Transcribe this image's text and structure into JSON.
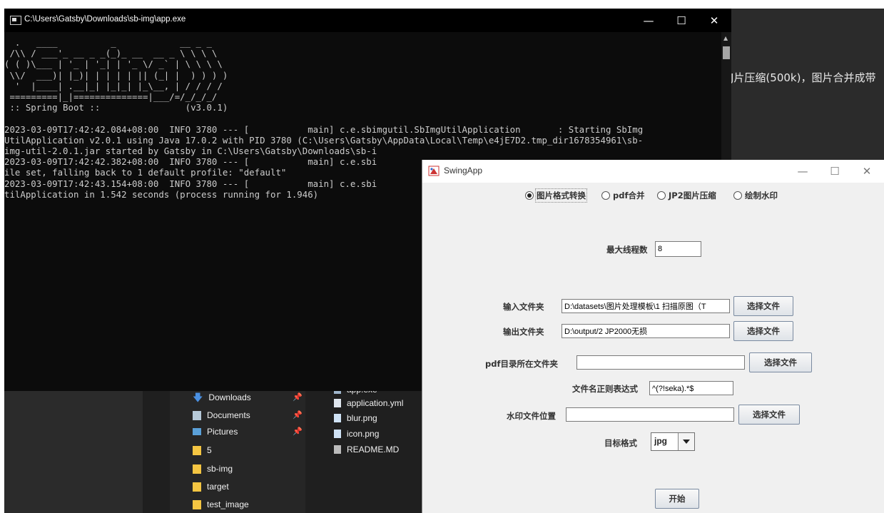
{
  "background": {
    "partial_text": "J片压缩(500k)，图片合并成带"
  },
  "explorer": {
    "nav_items": [
      {
        "label": "Downloads",
        "icon": "download-arrow-icon",
        "pinned": true
      },
      {
        "label": "Documents",
        "icon": "document-icon",
        "pinned": true
      },
      {
        "label": "Pictures",
        "icon": "pictures-icon",
        "pinned": true
      },
      {
        "label": "5",
        "icon": "folder-icon",
        "pinned": false
      },
      {
        "label": "sb-img",
        "icon": "folder-icon",
        "pinned": false
      },
      {
        "label": "target",
        "icon": "folder-icon",
        "pinned": false
      },
      {
        "label": "test_image",
        "icon": "folder-icon",
        "pinned": false
      }
    ],
    "files": [
      {
        "label": "app.exe"
      },
      {
        "label": "application.yml"
      },
      {
        "label": "blur.png"
      },
      {
        "label": "icon.png"
      },
      {
        "label": "README.MD"
      }
    ]
  },
  "console": {
    "title": "C:\\Users\\Gatsby\\Downloads\\sb-img\\app.exe",
    "controls": {
      "minimize": "—",
      "maximize": "☐",
      "close": "✕"
    },
    "output": "  .   ____          _            __ _ _\n /\\\\ / ___'_ __ _ _(_)_ __  __ _ \\ \\ \\ \\\n( ( )\\___ | '_ | '_| | '_ \\/ _` | \\ \\ \\ \\\n \\\\/  ___)| |_)| | | | | || (_| |  ) ) ) )\n  '  |____| .__|_| |_|_| |_\\__, | / / / /\n =========|_|==============|___/=/_/_/_/\n :: Spring Boot ::                (v3.0.1)\n\n2023-03-09T17:42:42.084+08:00  INFO 3780 --- [           main] c.e.sbimgutil.SbImgUtilApplication       : Starting SbImg\nUtilApplication v2.0.1 using Java 17.0.2 with PID 3780 (C:\\Users\\Gatsby\\AppData\\Local\\Temp\\e4jE7D2.tmp_dir1678354961\\sb-\nimg-util-2.0.1.jar started by Gatsby in C:\\Users\\Gatsby\\Downloads\\sb-i\n2023-03-09T17:42:42.382+08:00  INFO 3780 --- [           main] c.e.sbi\nile set, falling back to 1 default profile: \"default\"\n2023-03-09T17:42:43.154+08:00  INFO 3780 --- [           main] c.e.sbi\ntilApplication in 1.542 seconds (process running for 1.946)"
  },
  "swing": {
    "title": "SwingApp",
    "controls": {
      "minimize": "—",
      "maximize": "☐",
      "close": "✕"
    },
    "radios": [
      {
        "label": "图片格式转换",
        "selected": true
      },
      {
        "label": "pdf合并",
        "selected": false
      },
      {
        "label": "JP2图片压缩",
        "selected": false
      },
      {
        "label": "绘制水印",
        "selected": false
      }
    ],
    "max_threads_label": "最大线程数",
    "max_threads_value": "8",
    "input_folder_label": "输入文件夹",
    "input_folder_value": "D:\\datasets\\图片处理模板\\1 扫描原图（T",
    "output_folder_label": "输出文件夹",
    "output_folder_value": "D:\\output/2 JP2000无损",
    "pdf_folder_label": "pdf目录所在文件夹",
    "pdf_folder_value": "",
    "regex_label": "文件名正则表达式",
    "regex_value": "^(?!seka).*$",
    "watermark_label": "水印文件位置",
    "watermark_value": "",
    "choose_file_label": "选择文件",
    "target_format_label": "目标格式",
    "target_format_value": "jpg",
    "start_label": "开始"
  }
}
